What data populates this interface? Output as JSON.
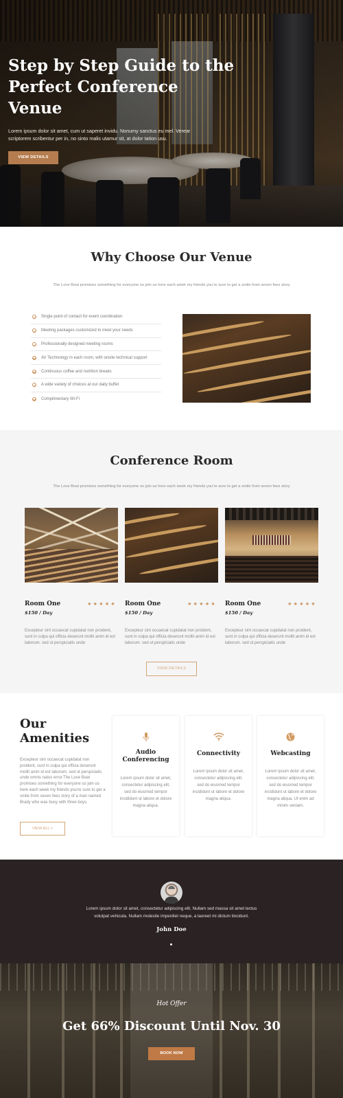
{
  "hero": {
    "title": "Step by Step Guide to the Perfect Conference Venue",
    "text": "Lorem ipsum dolor sit amet, cum ut saperet invidu. Nonumy sanctus eu mel. Verear scriptorem scribentur per in, no sinto malis utamur sit, at dolor tation usu.",
    "button": "VIEW DETAILS"
  },
  "why": {
    "title": "Why Choose Our Venue",
    "subtitle": "The Love Boat promises something for everyone so join us here each week my friends you're sure to get a smile from seven fees story",
    "features": [
      "Single point of contact for event coordination",
      "Meeting packages customized to meet your needs",
      "Professionally designed meeting rooms",
      "AV Technology in each room, with onsite technical support",
      "Continuous coffee and nutrition breaks",
      "A wide variety of choices at our daily buffet",
      "Complimentary Wi-Fi"
    ]
  },
  "conference": {
    "title": "Conference Room",
    "subtitle": "The Love Boat promises something for everyone so join us here each week my friends you're sure to get a smile from seven fees story",
    "rooms": [
      {
        "name": "Room One",
        "price": "$150 / Day",
        "stars": "★★★★★",
        "desc": "Excepteur sint occaecat cupidatat non proident, sunt in culpa qui officia deserunt mollit anim id est laborum. sed ut perspiciatis unde"
      },
      {
        "name": "Room One",
        "price": "$150 / Day",
        "stars": "★★★★★",
        "desc": "Excepteur sint occaecat cupidatat non proident, sunt in culpa qui officia deserunt mollit anim id est laborum. sed ut perspiciatis unde"
      },
      {
        "name": "Room One",
        "price": "$150 / Day",
        "stars": "★★★★★",
        "desc": "Excepteur sint occaecat cupidatat non proident, sunt in culpa qui officia deserunt mollit anim id est laborum. sed ut perspiciatis unde"
      }
    ],
    "button": "VIEW DETAILS"
  },
  "amenities": {
    "title_line1": "Our",
    "title_line2": "Amenities",
    "text": "Excepteur sint occaecat cupidatat non proident, sunt in culpa qui officia deserunt mollit anim id est laborum. sed ut perspiciatis unde omnis natus error.The Love Boat promises something for everyone so join us here each week my friends you're sure to get a smile from seven fees story of a man named Brady who was busy with three boys.",
    "button": "VIEW ALL >",
    "cards": [
      {
        "icon": "microphone-icon",
        "title": "Audio Conferencing",
        "text": "Lorem ipsum dolor sit amet, consectetur adipiscing elit, sed do eiusmod tempor incididunt ut labore et dolore magna aliqua."
      },
      {
        "icon": "wifi-icon",
        "title": "Connectivity",
        "text": "Lorem ipsum dolor sit amet, consectetur adipiscing elit, sed do eiusmod tempor incididunt ut labore et dolore magna aliqua."
      },
      {
        "icon": "globe-icon",
        "title": "Webcasting",
        "text": "Lorem ipsum dolor sit amet, consectetur adipiscing elit, sed do eiusmod tempor incididunt ut labore et dolore magna aliqua. Ut enim ad minim veniam."
      }
    ]
  },
  "testimonial": {
    "text": "Lorem ipsum dolor sit amet, consectetur adipiscing elit. Nullam sed massa sit amet lectus volutpat vehicula. Nullam molestie imperdiet neque, a laoreet mi dictum tincidunt.",
    "name": "John Doe"
  },
  "offer": {
    "subtitle": "Hot Offer",
    "title": "Get 66% Discount Until Nov. 30",
    "button": "BOOK NOW"
  },
  "colors": {
    "accent": "#c98f5a",
    "dark": "#2a2223",
    "section_bg": "#f5f5f6"
  }
}
